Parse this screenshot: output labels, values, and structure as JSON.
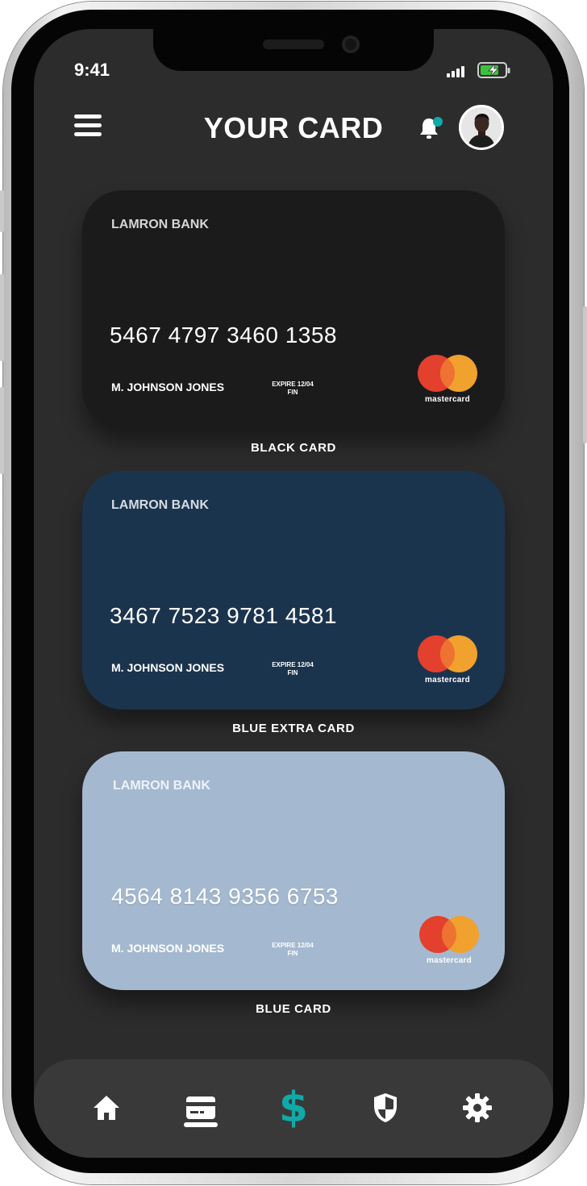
{
  "status_bar": {
    "time": "9:41"
  },
  "header": {
    "title": "YOUR CARD"
  },
  "theme": {
    "accent": "#0faaa8",
    "background": "#2d2c2d",
    "tabbar": "#3a393a"
  },
  "cards": [
    {
      "bank": "LAMRON BANK",
      "number": "5467 4797 3460 1358",
      "holder": "M. JOHNSON JONES",
      "expire_label": "EXPIRE",
      "expire_date": "12/04",
      "expire_sub": "FIN",
      "brand": "mastercard",
      "label": "BLACK CARD",
      "color": "#1c1b1c"
    },
    {
      "bank": "LAMRON BANK",
      "number": "3467 7523 9781 4581",
      "holder": "M. JOHNSON JONES",
      "expire_label": "EXPIRE",
      "expire_date": "12/04",
      "expire_sub": "FIN",
      "brand": "mastercard",
      "label": "BLUE EXTRA CARD",
      "color": "#1b344e"
    },
    {
      "bank": "LAMRON BANK",
      "number": "4564 8143 9356 6753",
      "holder": "M. JOHNSON JONES",
      "expire_label": "EXPIRE",
      "expire_date": "12/04",
      "expire_sub": "FIN",
      "brand": "mastercard",
      "label": "BLUE CARD",
      "color": "#a4b9d0"
    }
  ],
  "tabbar": {
    "items": [
      {
        "icon": "home-icon",
        "active": false
      },
      {
        "icon": "credit-card-icon",
        "active": true
      },
      {
        "icon": "dollar-icon",
        "symbol": "$",
        "active": false
      },
      {
        "icon": "shield-icon",
        "active": false
      },
      {
        "icon": "gear-icon",
        "active": false
      }
    ]
  }
}
